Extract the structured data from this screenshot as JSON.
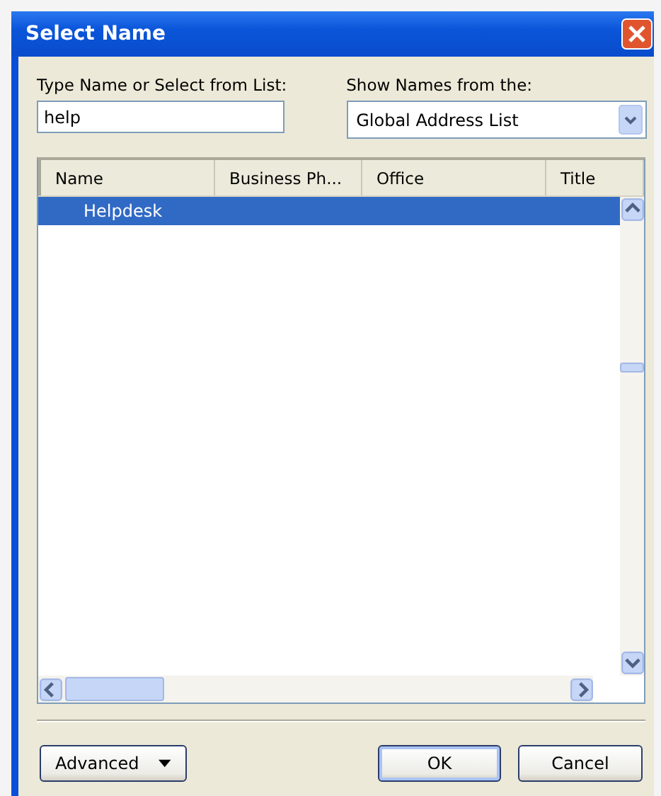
{
  "window": {
    "title": "Select Name"
  },
  "name_field": {
    "label": "Type Name or Select from List:",
    "value": "help"
  },
  "source": {
    "label": "Show Names from the:",
    "value": "Global Address List"
  },
  "list": {
    "columns": [
      "Name",
      "Business Ph...",
      "Office",
      "Title"
    ],
    "rows": [
      {
        "name": "Helpdesk",
        "selected": true
      }
    ]
  },
  "buttons": [
    {
      "label": "Advanced",
      "kind": "menu"
    },
    {
      "label": "OK",
      "kind": "default"
    },
    {
      "label": "Cancel",
      "kind": "plain"
    }
  ]
}
